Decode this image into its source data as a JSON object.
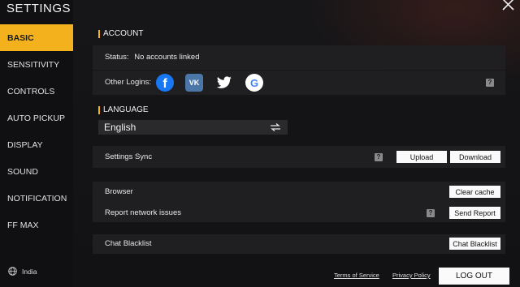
{
  "app": {
    "title": "SETTINGS"
  },
  "sidebar": {
    "items": [
      {
        "label": "BASIC",
        "active": true
      },
      {
        "label": "SENSITIVITY"
      },
      {
        "label": "CONTROLS"
      },
      {
        "label": "AUTO PICKUP"
      },
      {
        "label": "DISPLAY"
      },
      {
        "label": "SOUND"
      },
      {
        "label": "NOTIFICATION"
      },
      {
        "label": "FF MAX"
      }
    ],
    "region": "India"
  },
  "account": {
    "heading": "ACCOUNT",
    "status_label": "Status:",
    "status_value": "No accounts linked",
    "other_logins_label": "Other Logins:",
    "logins": [
      "facebook",
      "vk",
      "twitter",
      "google"
    ],
    "help": "?"
  },
  "language": {
    "heading": "LANGUAGE",
    "selected": "English"
  },
  "sync": {
    "label": "Settings Sync",
    "help": "?",
    "upload": "Upload",
    "download": "Download"
  },
  "browser": {
    "label": "Browser",
    "button": "Clear cache"
  },
  "network": {
    "label": "Report network issues",
    "help": "?",
    "button": "Send Report"
  },
  "chat": {
    "label": "Chat Blacklist",
    "button": "Chat Blacklist"
  },
  "footer": {
    "terms": "Terms of Service",
    "privacy": "Privacy Policy",
    "logout": "LOG OUT"
  },
  "colors": {
    "accent": "#f3b21d",
    "panel": "#1f1f22",
    "facebook": "#1877f2",
    "vk": "#4a76a8",
    "twitter": "#1da1f2"
  }
}
